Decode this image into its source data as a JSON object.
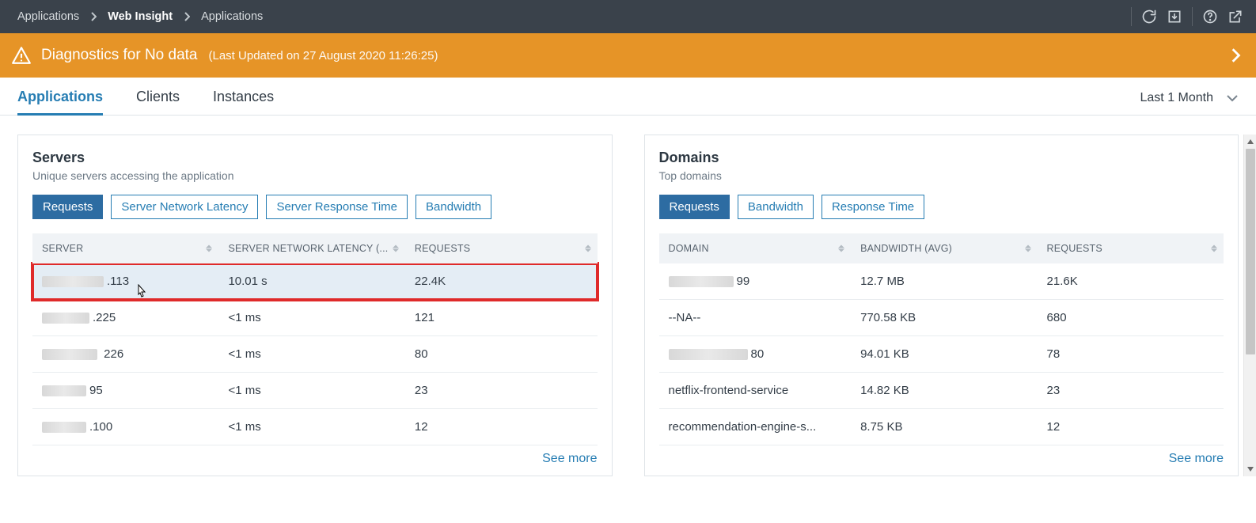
{
  "breadcrumb": {
    "items": [
      "Applications",
      "Web Insight",
      "Applications"
    ],
    "active_index": 1
  },
  "banner": {
    "title": "Diagnostics for No data",
    "meta": "(Last Updated on 27 August 2020 11:26:25)"
  },
  "tabs": {
    "items": [
      "Applications",
      "Clients",
      "Instances"
    ],
    "active_index": 0
  },
  "time_range": {
    "label": "Last 1 Month"
  },
  "servers_card": {
    "title": "Servers",
    "subtitle": "Unique servers accessing the application",
    "tabs": [
      "Requests",
      "Server Network Latency",
      "Server Response Time",
      "Bandwidth"
    ],
    "active_tab": 0,
    "columns": [
      "SERVER",
      "SERVER NETWORK LATENCY (...",
      "REQUESTS"
    ],
    "rows": [
      {
        "server_suffix": ".113",
        "blur_w": 78,
        "latency": "10.01 s",
        "requests": "22.4K",
        "highlight": true
      },
      {
        "server_suffix": ".225",
        "blur_w": 60,
        "latency": "<1 ms",
        "requests": "121"
      },
      {
        "server_suffix": " 226",
        "blur_w": 70,
        "latency": "<1 ms",
        "requests": "80"
      },
      {
        "server_suffix": "95",
        "blur_w": 56,
        "latency": "<1 ms",
        "requests": "23"
      },
      {
        "server_suffix": ".100",
        "blur_w": 56,
        "latency": "<1 ms",
        "requests": "12"
      }
    ],
    "see_more": "See more"
  },
  "domains_card": {
    "title": "Domains",
    "subtitle": "Top domains",
    "tabs": [
      "Requests",
      "Bandwidth",
      "Response Time"
    ],
    "active_tab": 0,
    "columns": [
      "DOMAIN",
      "BANDWIDTH (AVG)",
      "REQUESTS"
    ],
    "rows": [
      {
        "domain_suffix": "99",
        "blur_w": 82,
        "bandwidth": "12.7 MB",
        "requests": "21.6K"
      },
      {
        "domain_suffix": "--NA--",
        "blur_w": 0,
        "bandwidth": "770.58 KB",
        "requests": "680"
      },
      {
        "domain_suffix": "80",
        "blur_w": 100,
        "bandwidth": "94.01 KB",
        "requests": "78"
      },
      {
        "domain_suffix": "netflix-frontend-service",
        "blur_w": 0,
        "bandwidth": "14.82 KB",
        "requests": "23"
      },
      {
        "domain_suffix": "recommendation-engine-s...",
        "blur_w": 0,
        "bandwidth": "8.75 KB",
        "requests": "12"
      }
    ],
    "see_more": "See more"
  }
}
